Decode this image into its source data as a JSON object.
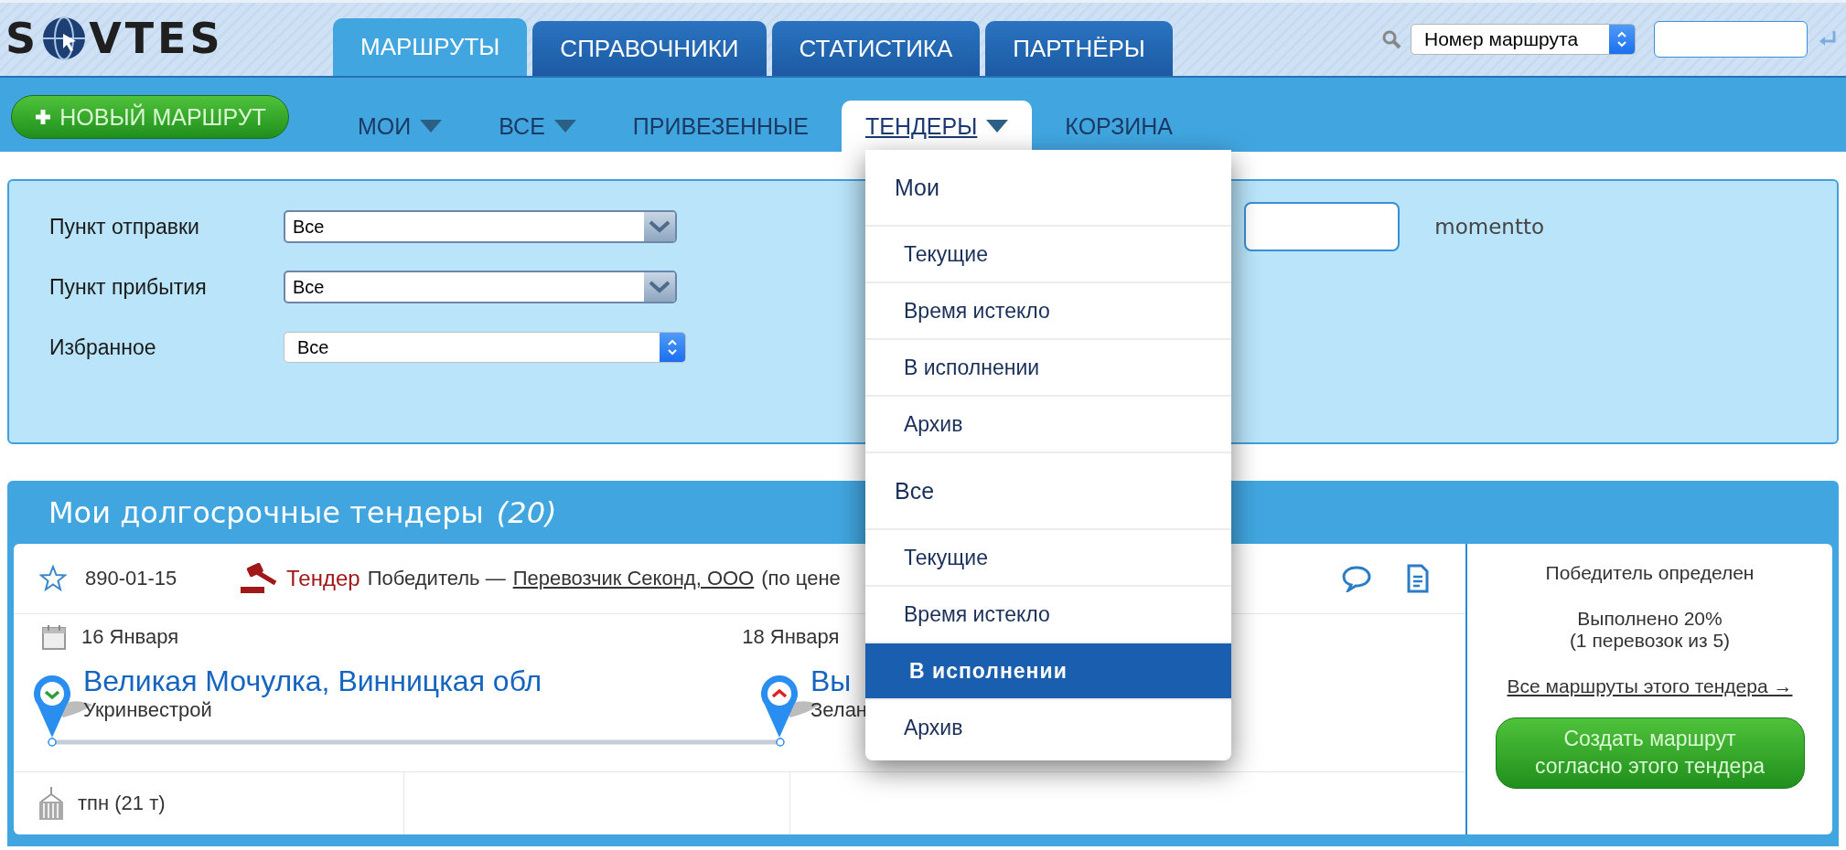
{
  "logo": {
    "left": "S",
    "right": "VTES"
  },
  "main_tabs": [
    {
      "label": "МАРШРУТЫ",
      "selected": true
    },
    {
      "label": "СПРАВОЧНИКИ",
      "selected": false
    },
    {
      "label": "СТАТИСТИКА",
      "selected": false
    },
    {
      "label": "ПАРТНЁРЫ",
      "selected": false
    }
  ],
  "search": {
    "select_value": "Номер маршрута"
  },
  "new_route_button": "НОВЫЙ МАРШРУТ",
  "sub_tabs": [
    {
      "label": "МОИ",
      "dropdown": true,
      "selected": false
    },
    {
      "label": "ВСЕ",
      "dropdown": true,
      "selected": false
    },
    {
      "label": "ПРИВЕЗЕННЫЕ",
      "dropdown": false,
      "selected": false
    },
    {
      "label": "ТЕНДЕРЫ",
      "dropdown": true,
      "selected": true
    },
    {
      "label": "КОРЗИНА",
      "dropdown": false,
      "selected": false
    }
  ],
  "filters": [
    {
      "label": "Пункт отправки",
      "value": "Все",
      "kind": "combo"
    },
    {
      "label": "Пункт прибытия",
      "value": "Все",
      "kind": "combo"
    },
    {
      "label": "Избранное",
      "value": "Все",
      "kind": "popup"
    }
  ],
  "user_label": "momentto",
  "dropdown": {
    "sections": [
      {
        "title": "Мои",
        "items": [
          {
            "label": "Текущие",
            "selected": false
          },
          {
            "label": "Время истекло",
            "selected": false
          },
          {
            "label": "В исполнении",
            "selected": false
          },
          {
            "label": "Архив",
            "selected": false
          }
        ]
      },
      {
        "title": "Все",
        "items": [
          {
            "label": "Текущие",
            "selected": false
          },
          {
            "label": "Время истекло",
            "selected": false
          },
          {
            "label": "В исполнении",
            "selected": true
          },
          {
            "label": "Архив",
            "selected": false
          }
        ]
      }
    ]
  },
  "section": {
    "title": "Мои долгосрочные тендеры",
    "count": "(20)"
  },
  "tender": {
    "starred": false,
    "number": "890-01-15",
    "type": "Тендер",
    "winner_text": "Победитель —",
    "carrier": "Перевозчик Секонд, ООО",
    "note": "(по цене",
    "date_from": "16 Января",
    "date_to": "18 Января",
    "origin": {
      "city": "Великая Мочулка, Винницкая обл",
      "company": "Укринвестрой"
    },
    "destination": {
      "city": "Вы",
      "company": "Зелан"
    },
    "cargo": "тпн (21 т)",
    "status": "Победитель определен",
    "progress": "Выполнено 20%",
    "progress_detail": "(1 перевозок из 5)",
    "routes_link": "Все маршруты этого тендера →",
    "create_button": "Создать маршрут согласно этого тендера"
  }
}
